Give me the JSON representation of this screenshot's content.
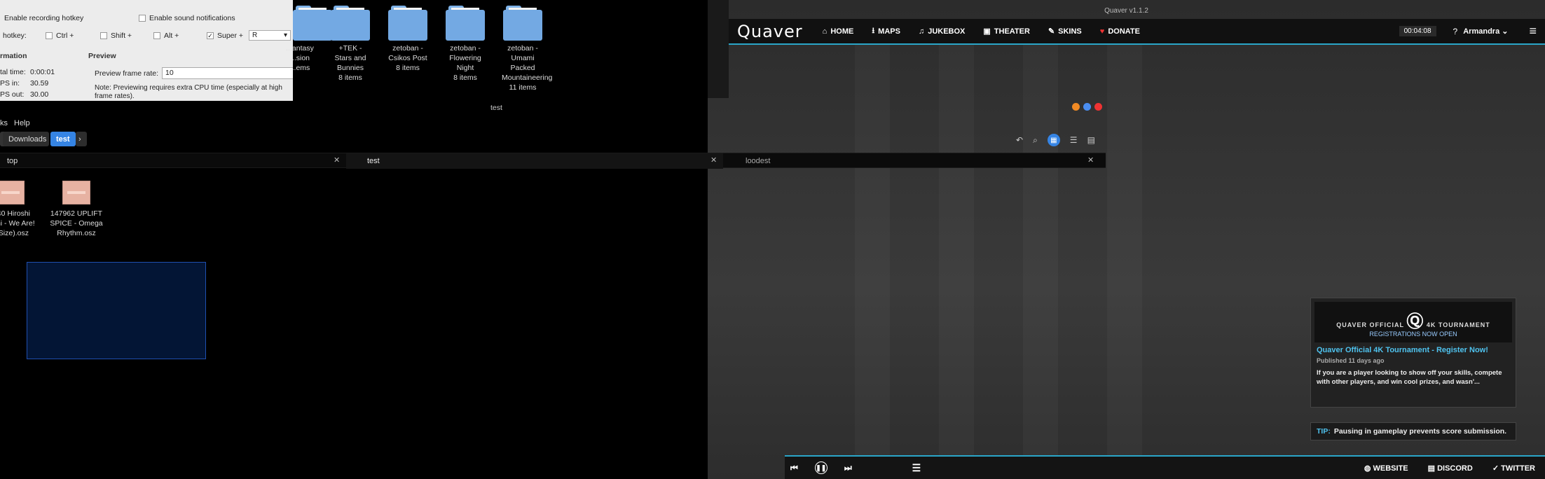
{
  "recorder": {
    "recording_hotkey_label": "Enable recording hotkey",
    "sound_label": "Enable sound notifications",
    "hotkey_label": "hotkey:",
    "mods": [
      {
        "label": "Ctrl +",
        "checked": false
      },
      {
        "label": "Shift +",
        "checked": false
      },
      {
        "label": "Alt +",
        "checked": false
      },
      {
        "label": "Super +",
        "checked": true
      }
    ],
    "key_value": "R",
    "info_header": "rmation",
    "preview_header": "Preview",
    "total_time_label": "tal time:",
    "total_time": "0:00:01",
    "fps_in_label": "PS in:",
    "fps_in": "30.59",
    "fps_out_label": "PS out:",
    "fps_out": "30.00",
    "frame_rate_label": "Preview frame rate:",
    "frame_rate_value": "10",
    "note": "Note: Previewing requires extra CPU time (especially at high frame rates)."
  },
  "folders": [
    {
      "name": "...antasy\n...sion",
      "count": "...ems"
    },
    {
      "name": "+TEK - Stars and Bunnies",
      "count": "8 items"
    },
    {
      "name": "zetoban - Csikos Post",
      "count": "8 items"
    },
    {
      "name": "zetoban - Flowering Night",
      "count": "8 items"
    },
    {
      "name": "zetoban - Umami Packed Mountaineering",
      "count": "11 items"
    }
  ],
  "folder_bar_label": "test",
  "menubar": [
    "ks",
    "Help"
  ],
  "breadcrumbs": [
    "Downloads",
    "test"
  ],
  "tabs": [
    {
      "label": "top"
    },
    {
      "label": "test"
    },
    {
      "label": "loodest"
    }
  ],
  "files": [
    {
      "name": "...40 Hiroshi\n...ani - We Are!\n...Size).osz"
    },
    {
      "name": "147962 UPLIFT\nSPICE - Omega\nRhythm.osz"
    }
  ],
  "quaver": {
    "window_title": "Quaver v1.1.2",
    "logo": "Quaver",
    "nav": [
      {
        "label": "HOME",
        "icon": "home-icon"
      },
      {
        "label": "MAPS",
        "icon": "download-icon"
      },
      {
        "label": "JUKEBOX",
        "icon": "music-icon"
      },
      {
        "label": "THEATER",
        "icon": "camera-icon"
      },
      {
        "label": "SKINS",
        "icon": "brush-icon"
      },
      {
        "label": "DONATE",
        "icon": "heart-icon"
      }
    ],
    "clock": "00:04:08",
    "help": "?",
    "user": "Armandra",
    "news": {
      "banner_left": "QUAVER OFFICIAL",
      "banner_right": "4K TOURNAMENT",
      "banner_sub": "REGISTRATIONS NOW OPEN",
      "title": "Quaver Official 4K Tournament - Register Now!",
      "published": "Published 11 days ago",
      "body": "If you are a player looking to show off your skills, compete with other players, and win cool prizes, and wasn'..."
    },
    "tip_label": "TIP:",
    "tip_text": "Pausing in gameplay prevents score submission.",
    "footer_links": [
      "WEBSITE",
      "DISCORD",
      "TWITTER"
    ],
    "accent": "#2aa6c9"
  }
}
